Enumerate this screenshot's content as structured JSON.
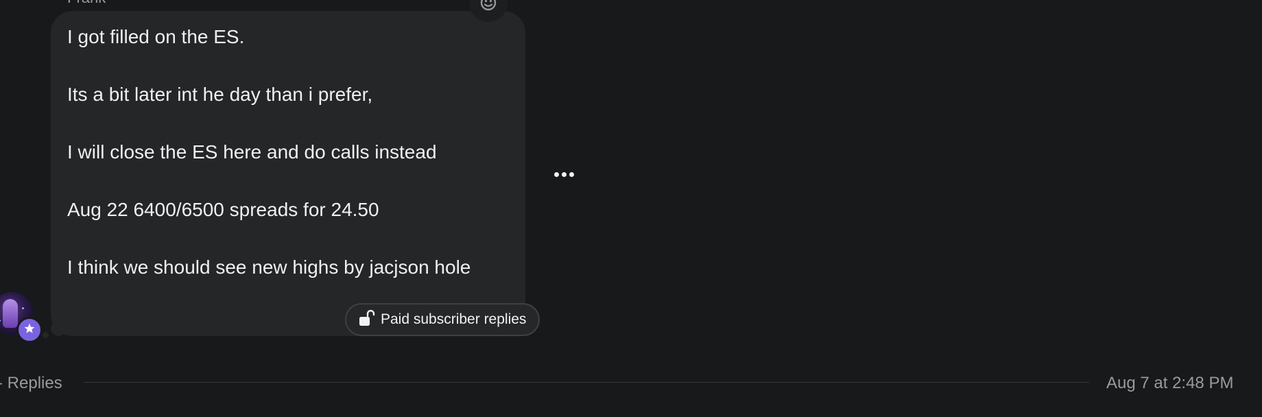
{
  "message": {
    "sender": "Frank",
    "lines": [
      "I got filled on the ES.",
      "Its a bit later int he day than i prefer,",
      "I will close the ES here and do calls instead",
      "Aug 22 6400/6500 spreads for 24.50",
      "I think we should see new highs by jacjson hole"
    ],
    "reply_permission_label": "Paid subscriber replies",
    "reply_permission_icon": "unlock-icon",
    "reaction_icon": "add-reaction-icon",
    "more_icon": "more-horizontal-icon"
  },
  "author": {
    "avatar_icon": "avatar",
    "badge_icon": "star-icon",
    "badge_color": "#7a63df"
  },
  "footer": {
    "replies_label": "- Replies",
    "timestamp": "Aug 7 at 2:48 PM"
  },
  "colors": {
    "background": "#18191b",
    "bubble": "#252627",
    "text": "#f0f0f1",
    "muted": "#9a9a9e"
  }
}
